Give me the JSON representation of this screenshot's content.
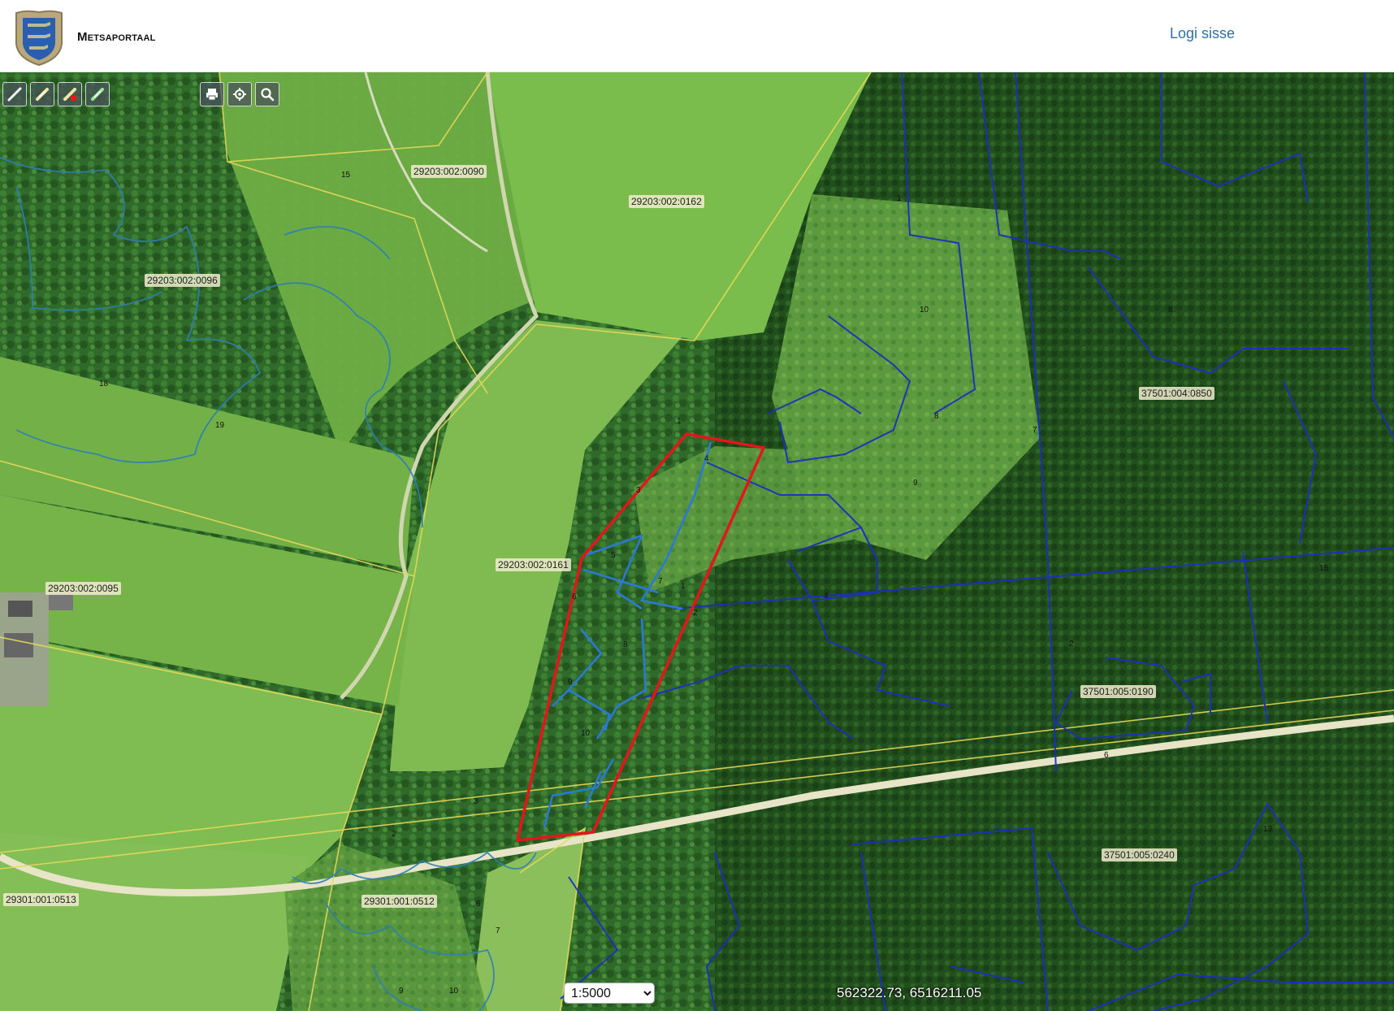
{
  "header": {
    "app_title": "Metsaportaal",
    "login_label": "Logi sisse"
  },
  "toolbar": {
    "draw_tools": [
      {
        "name": "draw-line-icon"
      },
      {
        "name": "draw-polygon-icon"
      },
      {
        "name": "erase-drawing-icon"
      },
      {
        "name": "edit-drawing-icon"
      }
    ],
    "map_tools": [
      {
        "name": "print-icon"
      },
      {
        "name": "locate-icon"
      },
      {
        "name": "search-icon"
      }
    ]
  },
  "parcels": [
    "29203:002:0090",
    "29203:002:0162",
    "29203:002:0096",
    "37501:004:0850",
    "29203:002:0161",
    "29203:002:0095",
    "37501:005:0190",
    "37501:005:0240",
    "29301:001:0513",
    "29301:001:0512"
  ],
  "stand_numbers": [
    "18",
    "19",
    "1",
    "3",
    "4",
    "5",
    "6",
    "7",
    "8",
    "9",
    "10",
    "1",
    "2",
    "4",
    "8",
    "7",
    "9",
    "10",
    "15",
    "2",
    "3",
    "2",
    "6",
    "7",
    "9",
    "10",
    "13",
    "8",
    "6",
    "15",
    "1"
  ],
  "footer": {
    "scale_value": "1:5000",
    "scale_options": [
      "1:5000"
    ],
    "coordinates": "562322.73, 6516211.05"
  },
  "colors": {
    "selection": "#e4161b",
    "stand_boundary": "#2b79d6",
    "forest_boundary": "#1a2fb8",
    "cadastre": "#e5d95a"
  }
}
